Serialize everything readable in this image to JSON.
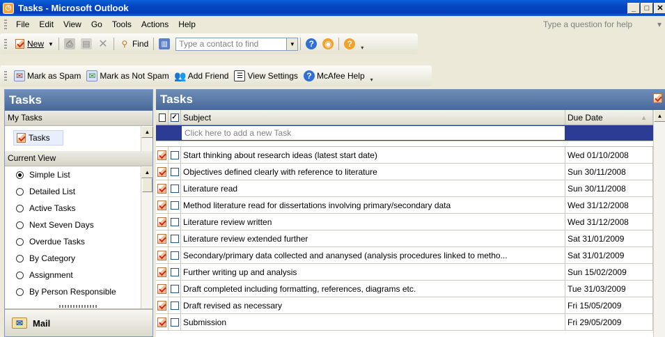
{
  "window": {
    "title": "Tasks - Microsoft Outlook"
  },
  "menu": {
    "items": [
      {
        "label": "File"
      },
      {
        "label": "Edit"
      },
      {
        "label": "View"
      },
      {
        "label": "Go"
      },
      {
        "label": "Tools"
      },
      {
        "label": "Actions"
      },
      {
        "label": "Help"
      }
    ],
    "help_placeholder": "Type a question for help"
  },
  "toolbar_standard": {
    "new_label": "New",
    "find_label": "Find",
    "contact_placeholder": "Type a contact to find"
  },
  "toolbar_addons": {
    "spam_label": "Mark as Spam",
    "not_spam_label": "Mark as Not Spam",
    "add_friend_label": "Add Friend",
    "view_settings_label": "View Settings",
    "mcafee_help_label": "McAfee Help"
  },
  "nav": {
    "title": "Tasks",
    "my_tasks_header": "My Tasks",
    "folder_label": "Tasks",
    "current_view_header": "Current View",
    "views": [
      {
        "label": "Simple List",
        "selected": true
      },
      {
        "label": "Detailed List",
        "selected": false
      },
      {
        "label": "Active Tasks",
        "selected": false
      },
      {
        "label": "Next Seven Days",
        "selected": false
      },
      {
        "label": "Overdue Tasks",
        "selected": false
      },
      {
        "label": "By Category",
        "selected": false
      },
      {
        "label": "Assignment",
        "selected": false
      },
      {
        "label": "By Person Responsible",
        "selected": false
      }
    ],
    "mail_label": "Mail"
  },
  "main": {
    "title": "Tasks",
    "columns": {
      "subject": "Subject",
      "due": "Due Date",
      "sort_indicator": "▲"
    },
    "new_task_placeholder": "Click here to add a new Task",
    "tasks": [
      {
        "subject": "Start thinking about research ideas (latest start date)",
        "due": "Wed 01/10/2008"
      },
      {
        "subject": "Objectives defined clearly with reference to literature",
        "due": "Sun 30/11/2008"
      },
      {
        "subject": "Literature read",
        "due": "Sun 30/11/2008"
      },
      {
        "subject": "Method literature read for dissertations involving primary/secondary data",
        "due": "Wed 31/12/2008"
      },
      {
        "subject": "Literature review written",
        "due": "Wed 31/12/2008"
      },
      {
        "subject": "Literature review extended further",
        "due": "Sat 31/01/2009"
      },
      {
        "subject": "Secondary/primary data collected and ananysed (analysis procedures linked to metho...",
        "due": "Sat 31/01/2009"
      },
      {
        "subject": "Further writing up and analysis",
        "due": "Sun 15/02/2009"
      },
      {
        "subject": "Draft completed including formatting, references, diagrams etc.",
        "due": "Tue 31/03/2009"
      },
      {
        "subject": "Draft revised as necessary",
        "due": "Fri 15/05/2009"
      },
      {
        "subject": "Submission",
        "due": "Fri 29/05/2009"
      }
    ]
  },
  "colors": {
    "titlebar": "#0446c0",
    "pane_header": "#5a79a8",
    "selection": "#2c3c95"
  }
}
